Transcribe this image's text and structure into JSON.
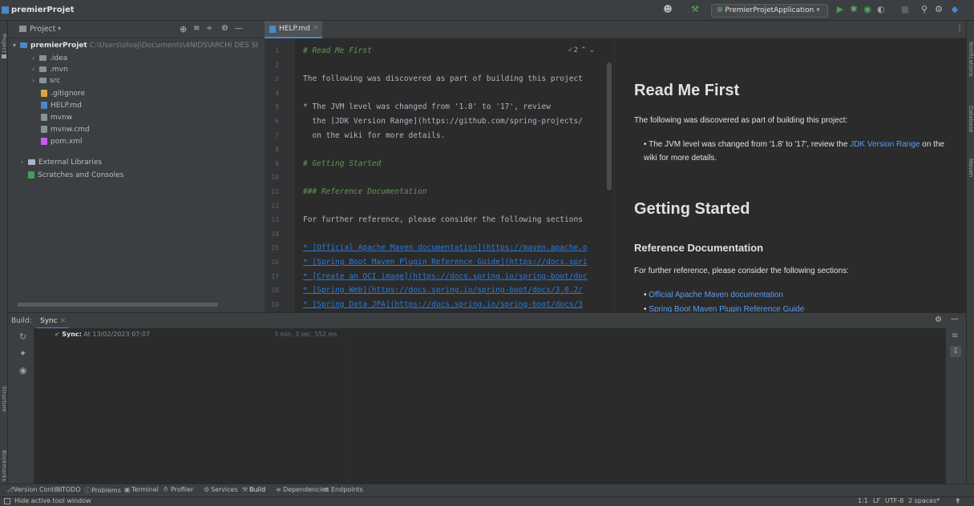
{
  "window": {
    "project_name": "premierProjet"
  },
  "toolbar": {
    "run_config": "PremierProjetApplication"
  },
  "left_stripe": {
    "project": "Project",
    "structure": "Structure",
    "bookmarks": "Bookmarks"
  },
  "right_stripe": {
    "notifications": "Notifications",
    "database": "Database",
    "maven": "Maven"
  },
  "project_panel": {
    "dropdown": "Project",
    "root_name": "premierProjet",
    "root_path": "C:\\Users\\oloaj\\Documents\\4NIDS\\ARCHI DES SI",
    "items": [
      {
        "label": ".idea",
        "type": "folder"
      },
      {
        "label": ".mvn",
        "type": "folder"
      },
      {
        "label": "src",
        "type": "folder"
      },
      {
        "label": ".gitignore",
        "type": "file"
      },
      {
        "label": "HELP.md",
        "type": "file"
      },
      {
        "label": "mvnw",
        "type": "file"
      },
      {
        "label": "mvnw.cmd",
        "type": "file"
      },
      {
        "label": "pom.xml",
        "type": "file"
      }
    ],
    "external_libraries": "External Libraries",
    "scratches": "Scratches and Consoles"
  },
  "editor": {
    "tab_label": "HELP.md",
    "inspection_count": "2",
    "lines": [
      {
        "n": "1",
        "text": "# Read Me First",
        "kind": "head"
      },
      {
        "n": "2",
        "text": "",
        "kind": "text"
      },
      {
        "n": "3",
        "text": "The following was discovered as part of building this project",
        "kind": "text"
      },
      {
        "n": "4",
        "text": "",
        "kind": "text"
      },
      {
        "n": "5",
        "text": "* The JVM level was changed from '1.8' to '17', review",
        "kind": "text"
      },
      {
        "n": "6",
        "text": "  the [JDK Version Range](https://github.com/spring-projects/",
        "kind": "link"
      },
      {
        "n": "7",
        "text": "  on the wiki for more details.",
        "kind": "text"
      },
      {
        "n": "8",
        "text": "",
        "kind": "text"
      },
      {
        "n": "9",
        "text": "# Getting Started",
        "kind": "head"
      },
      {
        "n": "10",
        "text": "",
        "kind": "text"
      },
      {
        "n": "11",
        "text": "### Reference Documentation",
        "kind": "head"
      },
      {
        "n": "12",
        "text": "",
        "kind": "text"
      },
      {
        "n": "13",
        "text": "For further reference, please consider the following sections",
        "kind": "text"
      },
      {
        "n": "14",
        "text": "",
        "kind": "text"
      },
      {
        "n": "15",
        "text": "* [Official Apache Maven documentation](https://maven.apache.o",
        "kind": "bullet"
      },
      {
        "n": "16",
        "text": "* [Spring Boot Maven Plugin Reference Guide](https://docs.spri",
        "kind": "bullet"
      },
      {
        "n": "17",
        "text": "* [Create an OCI image](https://docs.spring.io/spring-boot/doc",
        "kind": "bullet"
      },
      {
        "n": "18",
        "text": "* [Spring Web](https://docs.spring.io/spring-boot/docs/3.0.2/",
        "kind": "bullet"
      },
      {
        "n": "19",
        "text": "* [Spring Data JPA](https://docs.spring.io/spring-boot/docs/3",
        "kind": "bullet"
      }
    ]
  },
  "preview": {
    "h1_read_me": "Read Me First",
    "p_discovered": "The following was discovered as part of building this project:",
    "li_jvm_before": "The JVM level was changed from '1.8' to '17', review the ",
    "li_jvm_link": "JDK Version Range",
    "li_jvm_after": " on the wiki for more details.",
    "h1_getting_started": "Getting Started",
    "h3_reference": "Reference Documentation",
    "p_further": "For further reference, please consider the following sections:",
    "li_maven": "Official Apache Maven documentation",
    "li_plugin": "Spring Boot Maven Plugin Reference Guide"
  },
  "build": {
    "label": "Build:",
    "tab": "Sync",
    "sync_label": "Sync:",
    "sync_time": "At 13/02/2023 07:07",
    "duration": "3 min, 3 sec, 552 ms"
  },
  "tool_windows": [
    {
      "label": "Version Control",
      "icon": "vcs-icon"
    },
    {
      "label": "TODO",
      "icon": "todo-icon"
    },
    {
      "label": "Problems",
      "icon": "problems-icon"
    },
    {
      "label": "Terminal",
      "icon": "terminal-icon"
    },
    {
      "label": "Profiler",
      "icon": "profiler-icon"
    },
    {
      "label": "Services",
      "icon": "services-icon"
    },
    {
      "label": "Build",
      "icon": "build-icon"
    },
    {
      "label": "Dependencies",
      "icon": "dependencies-icon"
    },
    {
      "label": "Endpoints",
      "icon": "endpoints-icon"
    }
  ],
  "status": {
    "hint": "Hide active tool window",
    "position": "1:1",
    "line_sep": "LF",
    "encoding": "UTF-8",
    "indent": "2 spaces*"
  },
  "colors": {
    "accent_link": "#589df6",
    "success": "#59a869",
    "run": "#499c54"
  }
}
